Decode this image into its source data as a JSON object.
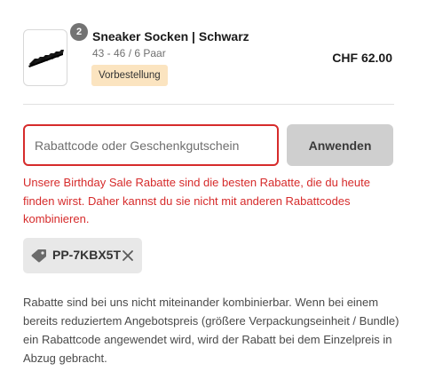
{
  "cart_item": {
    "quantity": "2",
    "title": "Sneaker Socken | Schwarz",
    "variant": "43 - 46 / 6 Paar",
    "tag": "Vorbestellung",
    "price": "CHF 62.00",
    "image_icon": "black-socks-icon"
  },
  "discount": {
    "placeholder": "Rabattcode oder Geschenkgutschein",
    "value": "",
    "apply_label": "Anwenden",
    "error": "Unsere Birthday Sale Rabatte sind die besten Rabatte, die du heute finden wirst. Daher kannst du sie nicht mit anderen Rabattcodes kombinieren.",
    "applied_code": "PP-7KBX5T",
    "applied_icon": "tag-icon",
    "remove_icon": "close-icon"
  },
  "note": "Rabatte sind bei uns nicht miteinander kombinierbar. Wenn bei einem bereits reduziertem Angebotspreis (größere Verpackungseinheit / Bundle) ein Rabattcode angewendet wird, wird der Rabatt bei dem Einzelpreis in Abzug gebracht.",
  "colors": {
    "error": "#d62b2b",
    "tag_bg": "#fbe4c0",
    "button_bg": "#cfcfcf",
    "chip_bg": "#e8e8e8",
    "badge_bg": "#737373"
  }
}
